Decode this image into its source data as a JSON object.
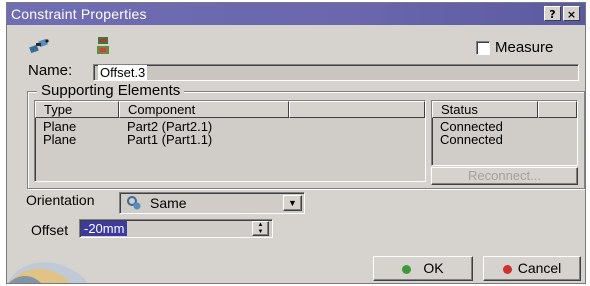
{
  "window": {
    "title": "Constraint Properties",
    "help_glyph": "?",
    "close_glyph": "×"
  },
  "toolbar": {
    "icons": [
      "constraint-link-icon",
      "components-icon"
    ]
  },
  "measure": {
    "label": "Measure",
    "checked": false
  },
  "name": {
    "label": "Name:",
    "value": "Offset.3"
  },
  "supporting": {
    "title": "Supporting Elements",
    "columns": [
      "Type",
      "Component"
    ],
    "rows": [
      {
        "type": "Plane",
        "component": "Part2 (Part2.1)"
      },
      {
        "type": "Plane",
        "component": "Part1 (Part1.1)"
      }
    ],
    "status_header": "Status",
    "statuses": [
      "Connected",
      "Connected"
    ],
    "reconnect_label": "Reconnect..."
  },
  "orientation": {
    "label": "Orientation",
    "value": "Same",
    "icon": "orientation-same-icon"
  },
  "offset": {
    "label": "Offset",
    "value": "-20mm"
  },
  "buttons": {
    "ok": "OK",
    "cancel": "Cancel"
  },
  "colors": {
    "title_bar": "#6b66ad",
    "ok_dot": "#3a9a3a",
    "cancel_dot": "#d03030",
    "selection": "#3d3a9e"
  }
}
